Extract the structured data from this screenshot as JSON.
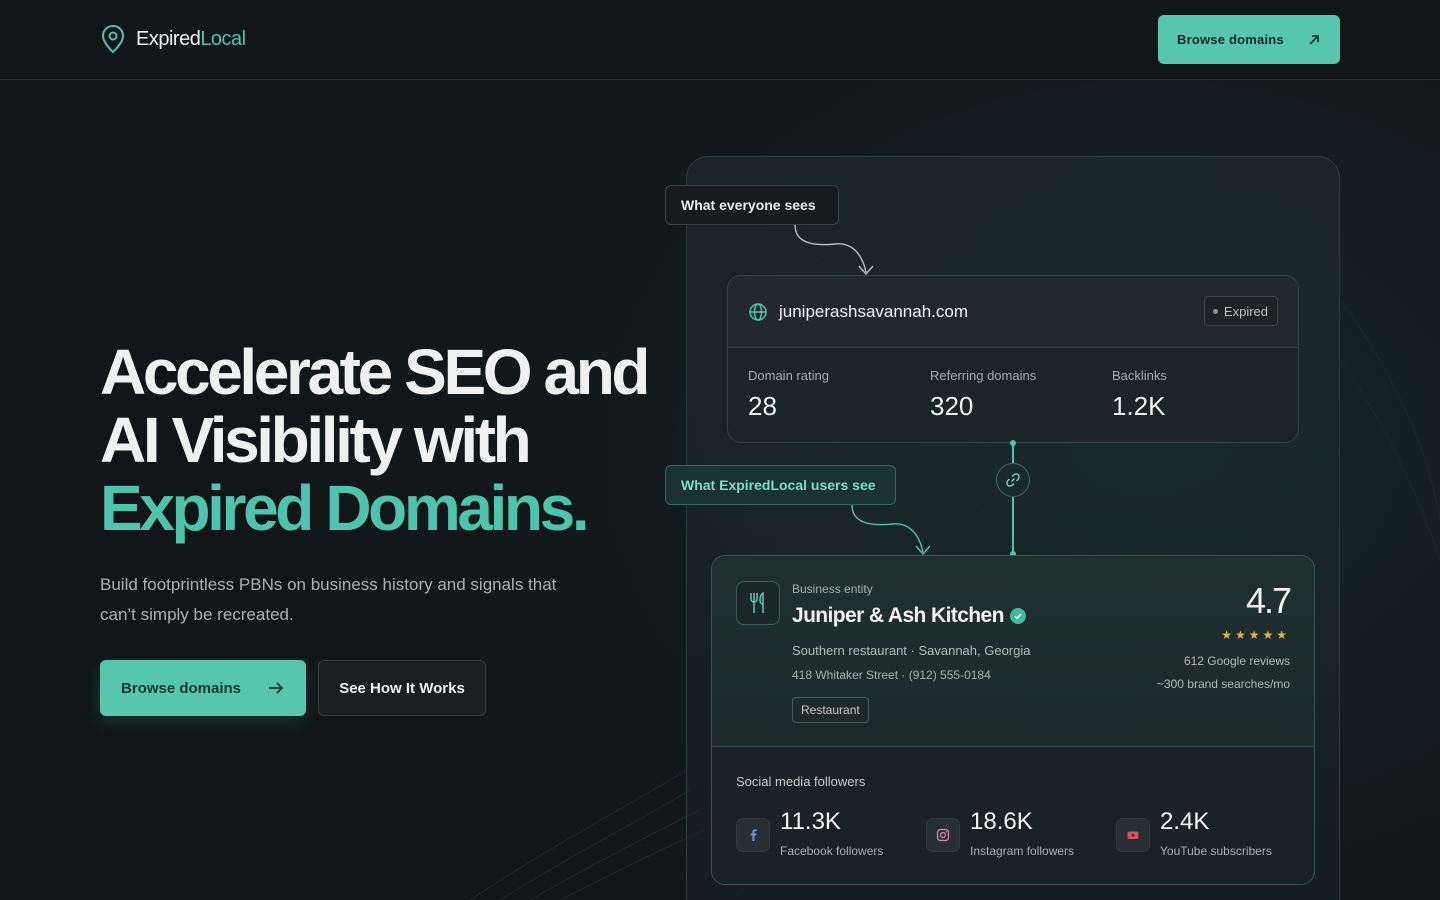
{
  "header": {
    "logo_part1": "Expired",
    "logo_part2": "Local",
    "cta_label": "Browse domains"
  },
  "hero": {
    "title_line1": "Accelerate SEO and",
    "title_line2": "AI Visibility with",
    "title_line3": "Expired Domains.",
    "subtitle": "Build footprintless PBNs on business history and signals that can’t simply be recreated.",
    "primary_cta": "Browse domains",
    "secondary_cta": "See How It Works"
  },
  "comparison": {
    "everyone_label": "What everyone sees",
    "users_label": "What ExpiredLocal users see"
  },
  "domain_card": {
    "domain": "juniperashsavannah.com",
    "status": "Expired",
    "metrics": [
      {
        "label": "Domain rating",
        "value": "28"
      },
      {
        "label": "Referring domains",
        "value": "320"
      },
      {
        "label": "Backlinks",
        "value": "1.2K"
      }
    ]
  },
  "business_card": {
    "kicker": "Business entity",
    "name": "Juniper & Ash Kitchen",
    "category_location": "Southern restaurant · Savannah, Georgia",
    "address_phone": "418 Whitaker Street · (912) 555-0184",
    "tag": "Restaurant",
    "rating": "4.7",
    "stars": "★★★★★",
    "reviews": "612 Google reviews",
    "brand_searches": "~300 brand searches/mo",
    "social_title": "Social media followers",
    "socials": [
      {
        "icon": "facebook-icon",
        "value": "11.3K",
        "label": "Facebook followers"
      },
      {
        "icon": "instagram-icon",
        "value": "18.6K",
        "label": "Instagram followers"
      },
      {
        "icon": "youtube-icon",
        "value": "2.4K",
        "label": "YouTube subscribers"
      }
    ]
  },
  "colors": {
    "accent": "#56c6ae",
    "background": "#121618",
    "star": "#e0b24a"
  }
}
